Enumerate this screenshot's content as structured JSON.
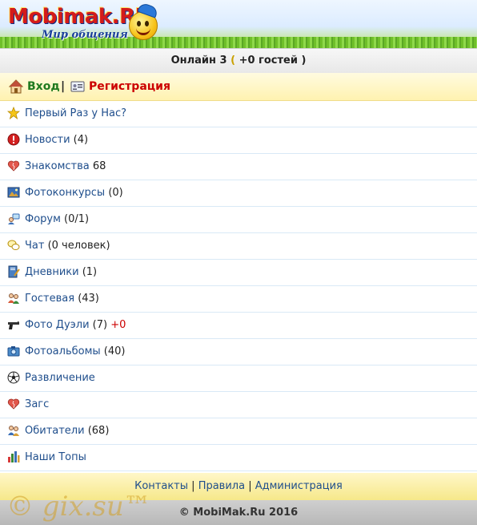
{
  "header": {
    "logo_text": "Mobimak.RU",
    "logo_subtitle": "Мир общения"
  },
  "online": {
    "prefix": "Онлайн 3",
    "open": "(",
    "guests": " +0 гостей ",
    "close": ")"
  },
  "auth": {
    "login_label": "Вход",
    "separator": "|",
    "register_label": "Регистрация"
  },
  "menu": [
    {
      "label": "Первый Раз у Нас?",
      "count": "",
      "icon": "star-icon"
    },
    {
      "label": "Новости",
      "count": " (4)",
      "icon": "alert-icon"
    },
    {
      "label": "Знакомства",
      "count": " 68",
      "icon": "heart-icon"
    },
    {
      "label": "Фотоконкурсы",
      "count": " (0)",
      "icon": "picture-icon"
    },
    {
      "label": "Форум",
      "count": " (0/1)",
      "icon": "forum-icon"
    },
    {
      "label": "Чат",
      "count": " (0 человек)",
      "icon": "chat-icon"
    },
    {
      "label": "Дневники",
      "count": " (1)",
      "icon": "notebook-icon"
    },
    {
      "label": "Гостевая",
      "count": " (43)",
      "icon": "guests-icon"
    },
    {
      "label": "Фото Дуэли",
      "count": " (7) ",
      "extra": "+0",
      "icon": "pistol-icon"
    },
    {
      "label": "Фотоальбомы",
      "count": " (40)",
      "icon": "camera-icon"
    },
    {
      "label": "Развличение",
      "count": "",
      "icon": "soccer-ball-icon"
    },
    {
      "label": "Загс",
      "count": "",
      "icon": "heart-icon"
    },
    {
      "label": "Обитатели",
      "count": " (68)",
      "icon": "people-icon"
    },
    {
      "label": "Наши Топы",
      "count": "",
      "icon": "bar-chart-icon"
    }
  ],
  "footer": {
    "contacts": "Контакты",
    "rules": "Правила",
    "admin": "Администрация",
    "bar": " | "
  },
  "copyright": "© MobiMak.Ru 2016",
  "watermark": "© gix.su™",
  "colors": {
    "link": "#1f4e8c",
    "login": "#1f7a1f",
    "register": "#cc0000",
    "accent_yellow": "#fff2b0"
  }
}
